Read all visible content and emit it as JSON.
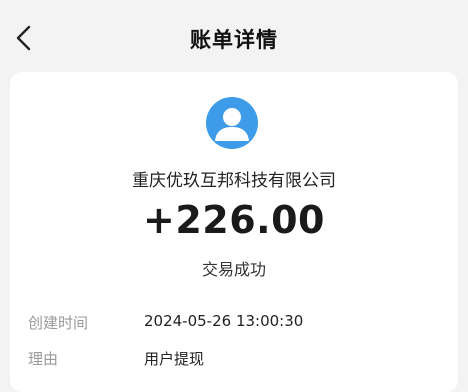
{
  "header": {
    "title": "账单详情",
    "back_icon": "chevron-left-icon"
  },
  "detail": {
    "avatar_icon": "user-avatar-icon",
    "company_name": "重庆优玖互邦科技有限公司",
    "amount": "+226.00",
    "status": "交易成功",
    "fields": [
      {
        "label": "创建时间",
        "value": "2024-05-26 13:00:30"
      },
      {
        "label": "理由",
        "value": "用户提现"
      }
    ]
  },
  "colors": {
    "accent": "#3d9bea",
    "background": "#f3f3f3",
    "card": "#ffffff",
    "label_gray": "#9a9a9a"
  }
}
